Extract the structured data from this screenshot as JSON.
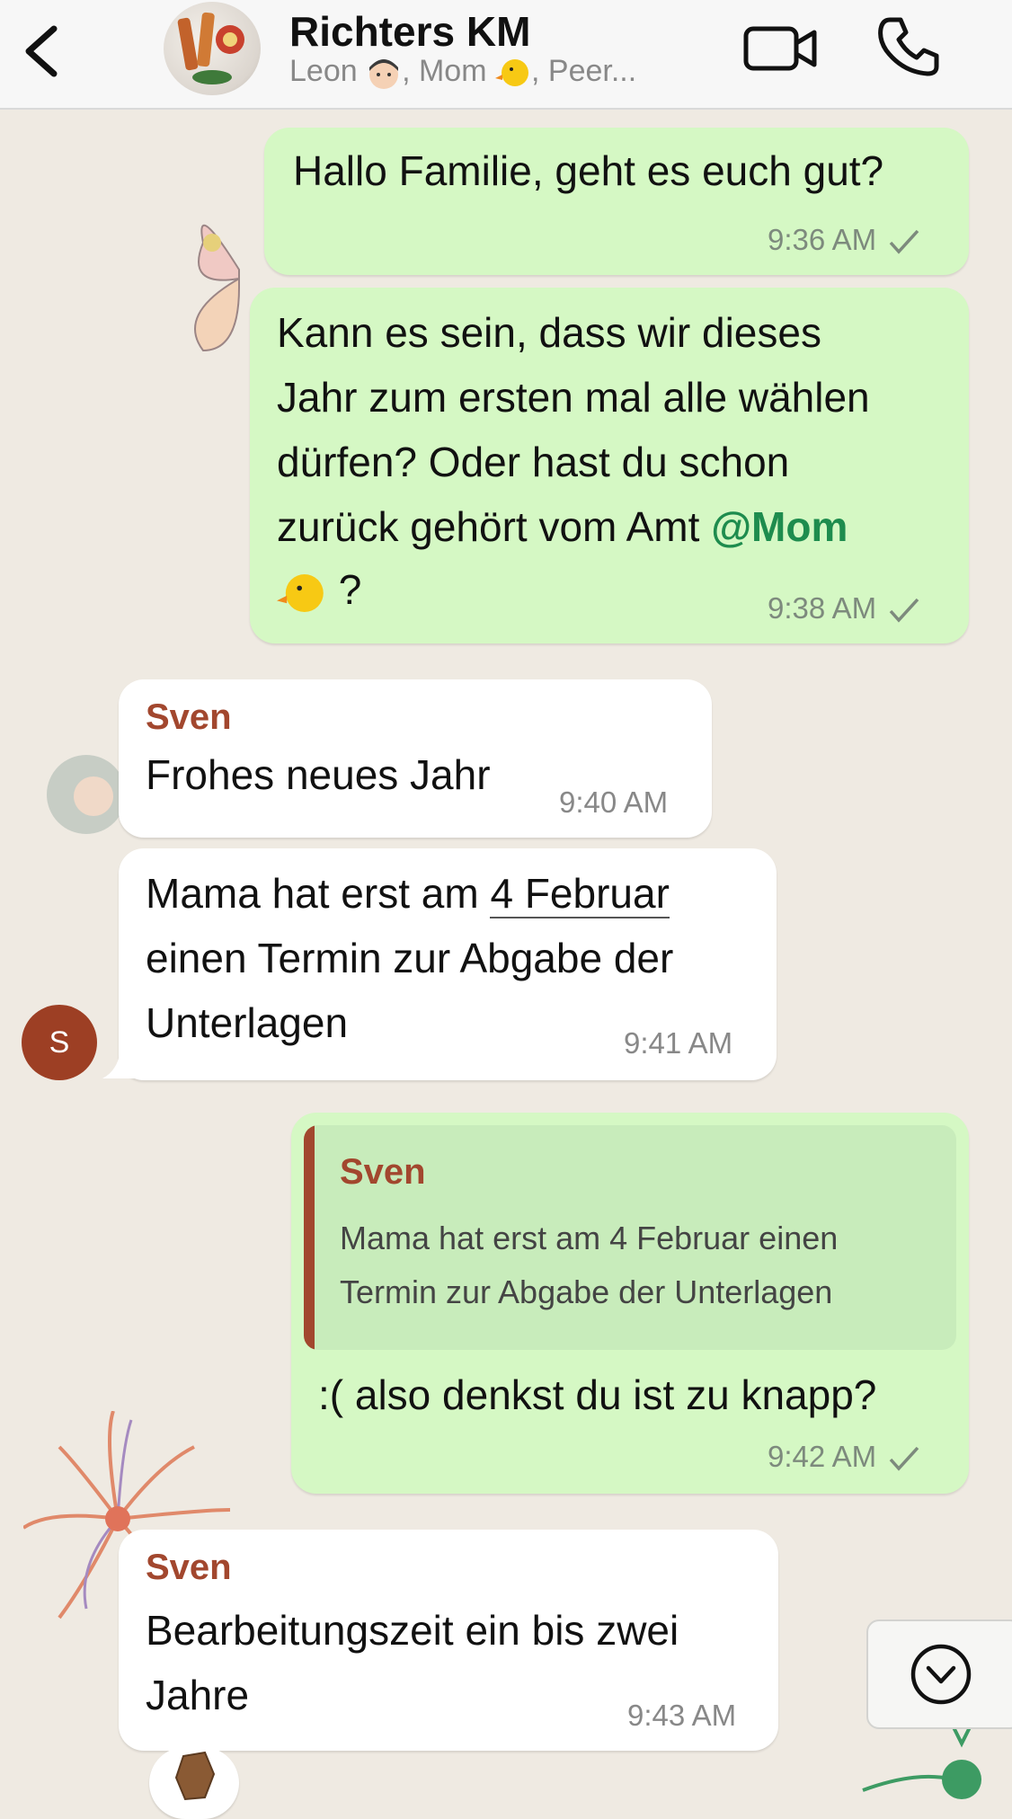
{
  "header": {
    "title": "Richters KM",
    "subtitle_parts": [
      "Leon",
      ", Mom",
      ", Peer..."
    ]
  },
  "messages": [
    {
      "id": "m1",
      "direction": "outgoing",
      "text_lines": [
        "Hallo Familie, geht es euch gut?"
      ],
      "time": "9:36 AM",
      "read": true
    },
    {
      "id": "m2",
      "direction": "outgoing",
      "text_lines": [
        "Kann es sein, dass wir dieses",
        "Jahr zum ersten mal alle wählen",
        "dürfen? Oder hast du schon",
        "zurück gehört vom Amt "
      ],
      "mention": "@Mom",
      "last_line_suffix": " ?",
      "time": "9:38 AM",
      "read": true
    },
    {
      "id": "m3",
      "direction": "incoming",
      "sender": "Sven",
      "text_lines": [
        "Frohes neues Jahr"
      ],
      "time": "9:40 AM"
    },
    {
      "id": "m4",
      "direction": "incoming",
      "text_lines_prefix": "Mama hat erst am ",
      "date_link": "4 Februar",
      "text_lines": [
        "einen Termin zur Abgabe der",
        "Unterlagen"
      ],
      "time": "9:41 AM"
    },
    {
      "id": "m5",
      "direction": "outgoing",
      "quote": {
        "sender": "Sven",
        "text_lines": [
          "Mama hat erst am 4 Februar einen",
          "Termin zur Abgabe der Unterlagen"
        ]
      },
      "text_lines": [
        ":( also denkst du ist zu knapp?"
      ],
      "time": "9:42 AM",
      "read": true
    },
    {
      "id": "m6",
      "direction": "incoming",
      "sender": "Sven",
      "text_lines": [
        "Bearbeitungszeit ein bis zwei",
        "Jahre"
      ],
      "time": "9:43 AM"
    }
  ],
  "avatar_initial": "S",
  "icons": {
    "back": "chevron-left-icon",
    "video": "video-camera-icon",
    "call": "phone-icon",
    "scroll": "chevron-down-circle-icon",
    "reaction": "coffin-emoji-icon"
  },
  "colors": {
    "outgoing_bubble": "#d5f8c4",
    "incoming_bubble": "#ffffff",
    "sender_name": "#a2472e",
    "mention": "#1e8c4e",
    "background": "#efeae2"
  }
}
